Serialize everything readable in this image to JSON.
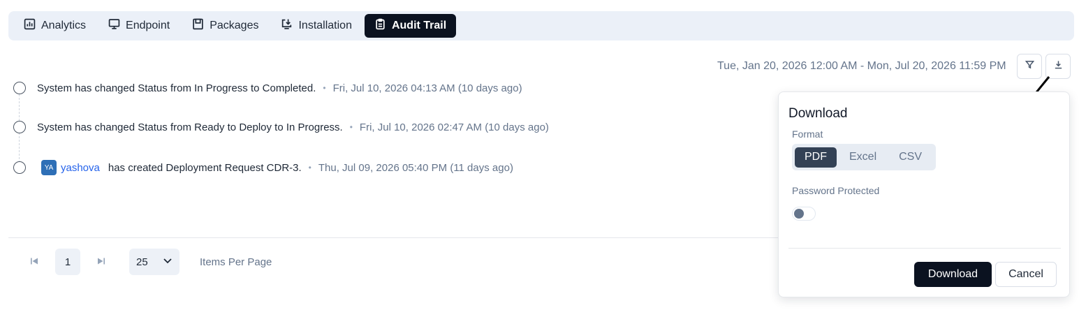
{
  "tabs": [
    {
      "label": "Analytics",
      "icon": "bar-chart-icon"
    },
    {
      "label": "Endpoint",
      "icon": "monitor-icon"
    },
    {
      "label": "Packages",
      "icon": "package-icon"
    },
    {
      "label": "Installation",
      "icon": "install-icon"
    },
    {
      "label": "Audit Trail",
      "icon": "clipboard-icon",
      "active": true
    }
  ],
  "date_range": "Tue, Jan 20, 2026 12:00 AM - Mon, Jul 20, 2026 11:59 PM",
  "events": [
    {
      "text": "System has changed Status from In Progress to Completed.",
      "time": "Fri, Jul 10, 2026 04:13 AM (10 days ago)"
    },
    {
      "text": "System has changed Status from Ready to Deploy to In Progress.",
      "time": "Fri, Jul 10, 2026 02:47 AM (10 days ago)"
    },
    {
      "avatar": "YA",
      "user": "yashova",
      "text": "has created Deployment Request CDR-3.",
      "time": "Thu, Jul 09, 2026 05:40 PM (11 days ago)"
    }
  ],
  "pagination": {
    "current_page": "1",
    "per_page": "25",
    "per_page_label": "Items Per Page"
  },
  "download_popover": {
    "title": "Download",
    "format_label": "Format",
    "formats": [
      "PDF",
      "Excel",
      "CSV"
    ],
    "selected_format": "PDF",
    "password_label": "Password Protected",
    "password_enabled": false,
    "download_label": "Download",
    "cancel_label": "Cancel"
  },
  "colors": {
    "tab_active_bg": "#0b1220",
    "tabs_bg": "#ebf0f8",
    "link": "#2563eb",
    "avatar_bg": "#2e6fb6"
  }
}
